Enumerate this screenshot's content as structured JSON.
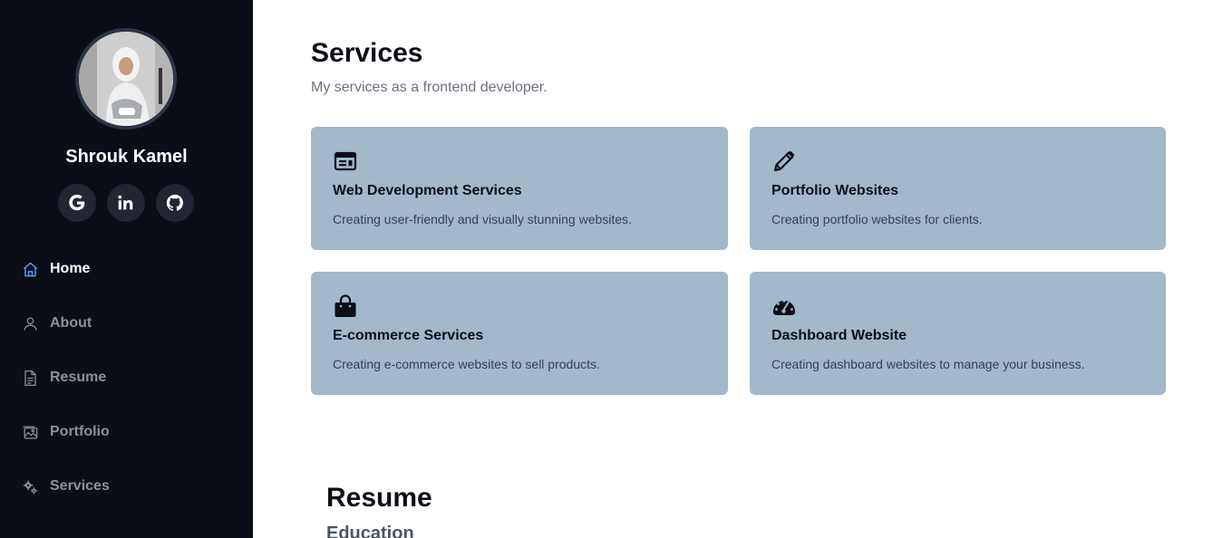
{
  "sidebar": {
    "profile_name": "Shrouk Kamel",
    "socials": [
      {
        "icon": "google-icon"
      },
      {
        "icon": "linkedin-icon"
      },
      {
        "icon": "github-icon"
      }
    ],
    "nav": [
      {
        "label": "Home",
        "icon": "home-icon",
        "active": true
      },
      {
        "label": "About",
        "icon": "user-icon"
      },
      {
        "label": "Resume",
        "icon": "document-icon"
      },
      {
        "label": "Portfolio",
        "icon": "image-icon"
      },
      {
        "label": "Services",
        "icon": "gears-icon"
      }
    ]
  },
  "services": {
    "title": "Services",
    "subtitle": "My services as a frontend developer.",
    "cards": [
      {
        "icon": "browser-window-icon",
        "title": "Web Development Services",
        "description": "Creating user-friendly and visually stunning websites."
      },
      {
        "icon": "pencil-icon",
        "title": "Portfolio Websites",
        "description": "Creating portfolio websites for clients."
      },
      {
        "icon": "shopping-bag-icon",
        "title": "E-commerce Services",
        "description": "Creating e-commerce websites to sell products."
      },
      {
        "icon": "speedometer-icon",
        "title": "Dashboard Website",
        "description": "Creating dashboard websites to manage your business."
      }
    ]
  },
  "resume": {
    "title": "Resume",
    "subtitle": "Education"
  },
  "colors": {
    "sidebar_bg": "#0b0e17",
    "card_bg": "#a2b8cb",
    "active_icon": "#5b9bff"
  }
}
